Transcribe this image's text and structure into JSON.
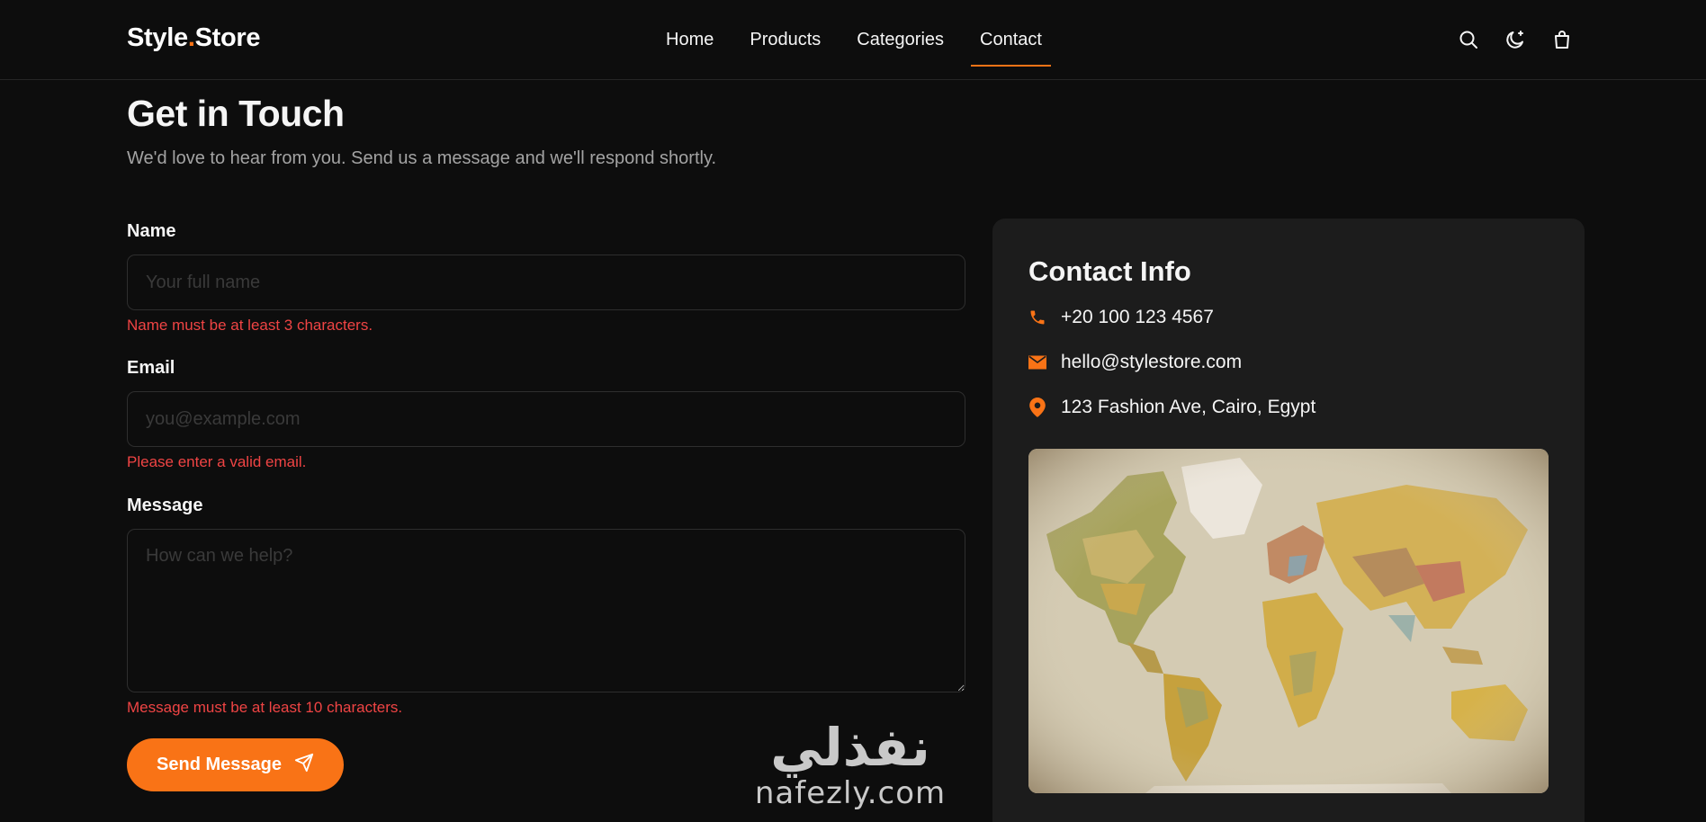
{
  "brand": {
    "name_part1": "Style",
    "dot": ".",
    "name_part2": "Store",
    "accent_color": "#f97316"
  },
  "nav": {
    "items": [
      {
        "label": "Home"
      },
      {
        "label": "Products"
      },
      {
        "label": "Categories"
      },
      {
        "label": "Contact",
        "active": true
      }
    ]
  },
  "header_icons": [
    "search-icon",
    "theme-toggle-icon",
    "shopping-bag-icon"
  ],
  "intro": {
    "title": "Get in Touch",
    "subtitle": "We'd love to hear from you. Send us a message and we'll respond shortly."
  },
  "form": {
    "name": {
      "label": "Name",
      "placeholder": "Your full name",
      "value": "",
      "error": "Name must be at least 3 characters."
    },
    "email": {
      "label": "Email",
      "placeholder": "you@example.com",
      "value": "",
      "error": "Please enter a valid email."
    },
    "message": {
      "label": "Message",
      "placeholder": "How can we help?",
      "value": "",
      "error": "Message must be at least 10 characters."
    },
    "submit_label": "Send Message",
    "error_color": "#ef4444"
  },
  "contact_info": {
    "title": "Contact Info",
    "phone": "+20 100 123 4567",
    "email": "hello@stylestore.com",
    "address": "123 Fashion Ave, Cairo, Egypt",
    "map_image": "world-map-image"
  },
  "watermark": {
    "arabic": "نفذلي",
    "latin": "nafezly.com"
  }
}
